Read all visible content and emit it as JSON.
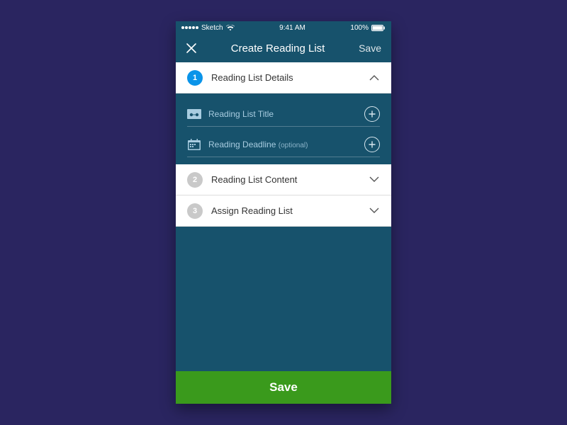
{
  "status": {
    "carrier": "Sketch",
    "time": "9:41 AM",
    "battery": "100%"
  },
  "nav": {
    "title": "Create Reading List",
    "save": "Save"
  },
  "sections": [
    {
      "num": "1",
      "label": "Reading List Details"
    },
    {
      "num": "2",
      "label": "Reading List Content"
    },
    {
      "num": "3",
      "label": "Assign Reading List"
    }
  ],
  "fields": {
    "title_label": "Reading List Title",
    "deadline_label": "Reading Deadline",
    "optional": "(optional)"
  },
  "footer": {
    "save": "Save"
  }
}
